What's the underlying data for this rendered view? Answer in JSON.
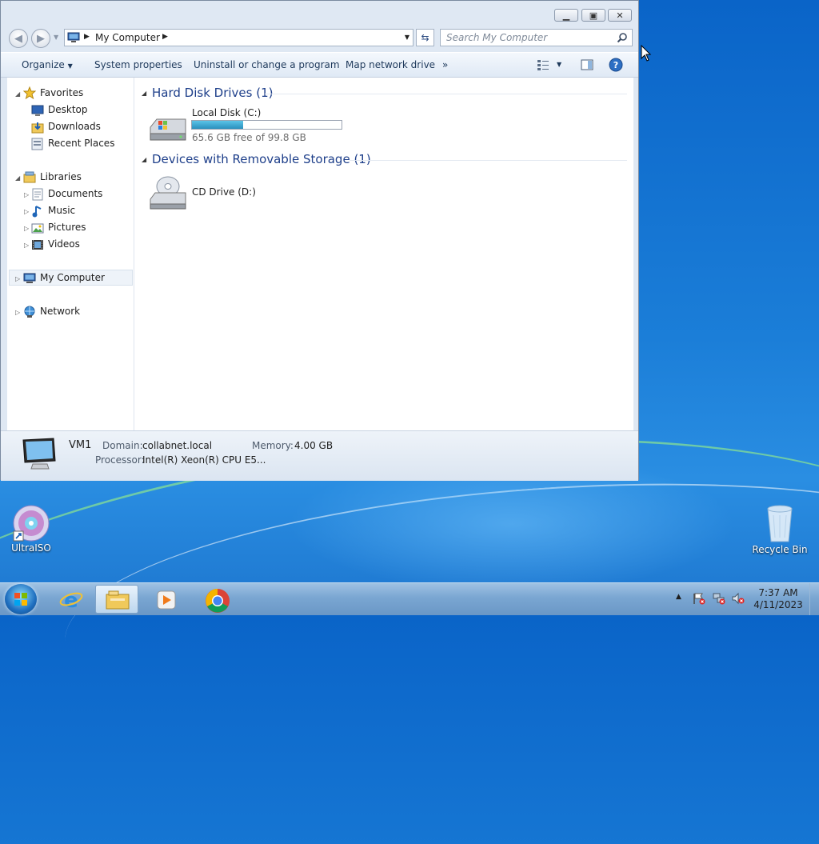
{
  "window": {
    "title_buttons": {
      "minimize": "minimize-icon",
      "maximize": "maximize-icon",
      "close": "close-icon"
    }
  },
  "address": {
    "location": "My Computer"
  },
  "search": {
    "placeholder": "Search My Computer"
  },
  "toolbar": {
    "organize": "Organize",
    "system_properties": "System properties",
    "uninstall": "Uninstall or change a program",
    "map_drive": "Map network drive",
    "more": "»"
  },
  "sidebar": {
    "favorites": {
      "label": "Favorites",
      "items": [
        {
          "label": "Desktop"
        },
        {
          "label": "Downloads"
        },
        {
          "label": "Recent Places"
        }
      ]
    },
    "libraries": {
      "label": "Libraries",
      "items": [
        {
          "label": "Documents"
        },
        {
          "label": "Music"
        },
        {
          "label": "Pictures"
        },
        {
          "label": "Videos"
        }
      ]
    },
    "computer": {
      "label": "My Computer"
    },
    "network": {
      "label": "Network"
    }
  },
  "content": {
    "groups": [
      {
        "title": "Hard Disk Drives (1)",
        "drives": [
          {
            "name": "Local Disk (C:)",
            "free_text": "65.6 GB free of 99.8 GB",
            "used_fraction": 0.343
          }
        ]
      },
      {
        "title": "Devices with Removable Storage (1)",
        "drives": [
          {
            "name": "CD Drive (D:)"
          }
        ]
      }
    ]
  },
  "details": {
    "computer_name": "VM1",
    "domain_label": "Domain:",
    "domain_value": "collabnet.local",
    "memory_label": "Memory:",
    "memory_value": "4.00 GB",
    "processor_label": "Processor:",
    "processor_value": "Intel(R) Xeon(R) CPU E5..."
  },
  "desktop": {
    "icons": [
      {
        "label": "UltraISO",
        "icon": "ultraiso-disc-icon"
      },
      {
        "label": "Recycle Bin",
        "icon": "recycle-bin-icon"
      }
    ]
  },
  "taskbar": {
    "apps": [
      "internet-explorer-icon",
      "windows-explorer-icon",
      "media-player-icon",
      "chrome-icon"
    ],
    "time": "7:37 AM",
    "date": "4/11/2023"
  }
}
